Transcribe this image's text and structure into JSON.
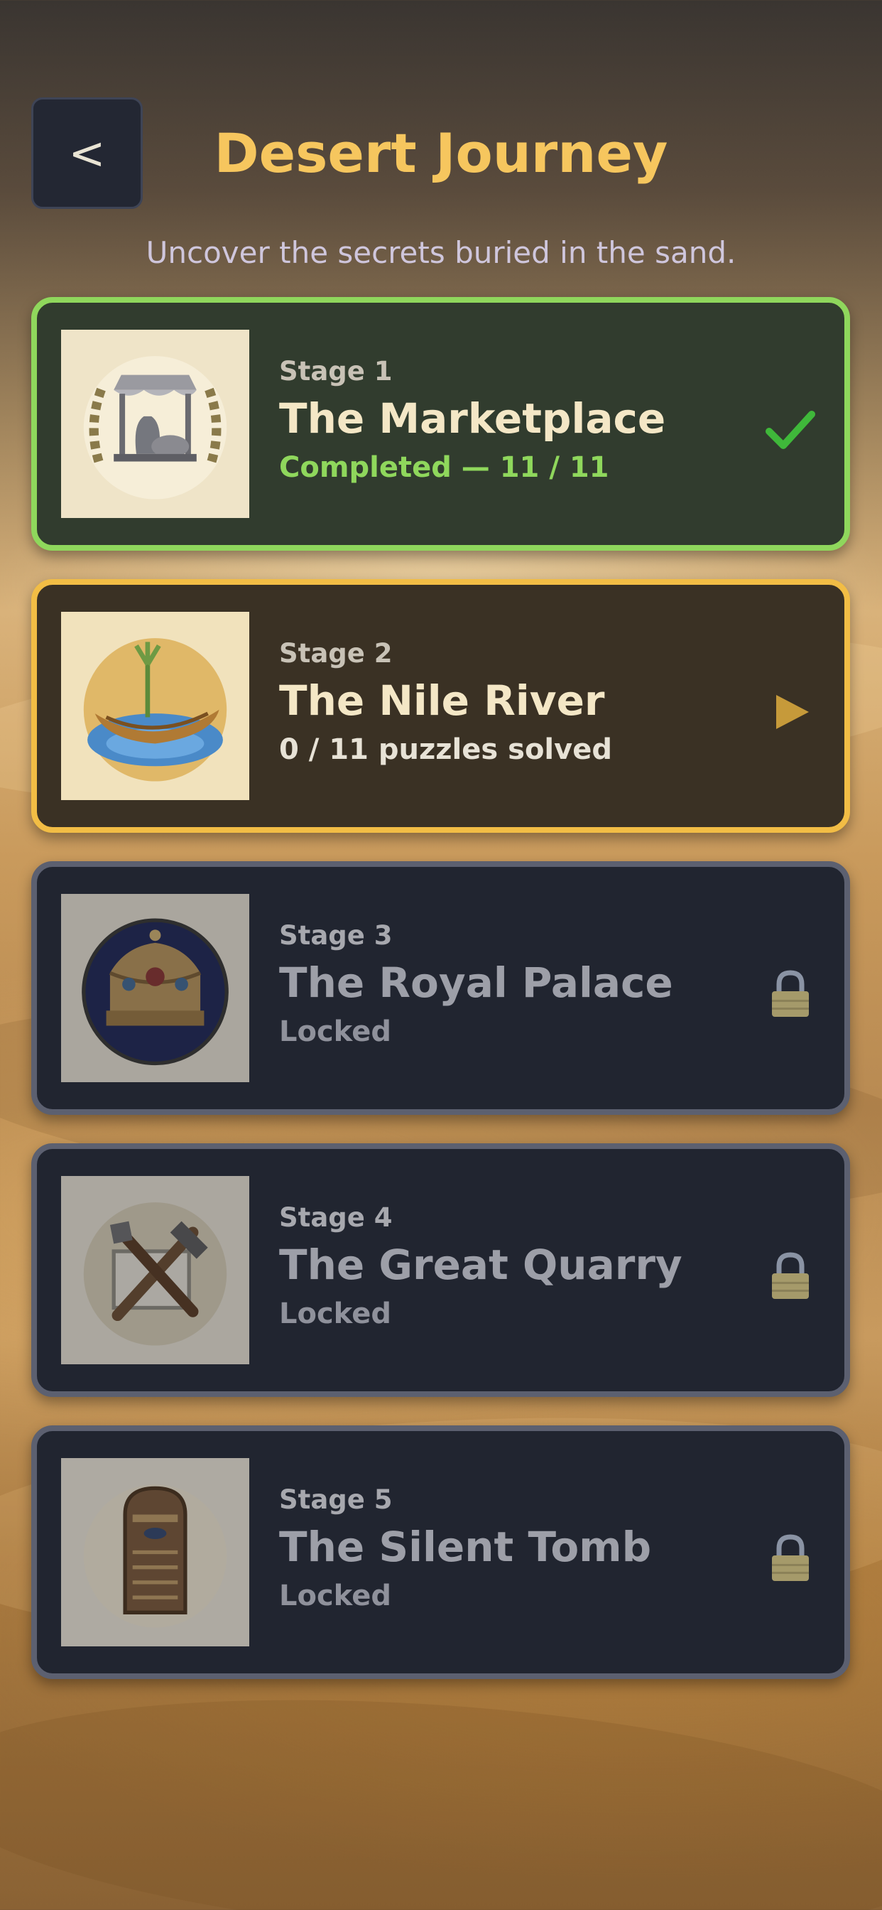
{
  "header": {
    "back_label": "<",
    "title": "Desert Journey",
    "subtitle": "Uncover the secrets buried in the sand."
  },
  "colors": {
    "title": "#f6c65e",
    "completed_accent": "#8fd75c",
    "current_accent": "#f2bd45",
    "locked_border": "#5c6070"
  },
  "stages": [
    {
      "number": "Stage 1",
      "name": "The Marketplace",
      "status": "Completed — 11 / 11",
      "state": "completed",
      "icon": "checkmark-icon",
      "thumbnail": "market-stall-emblem"
    },
    {
      "number": "Stage 2",
      "name": "The Nile River",
      "status": "0 / 11 puzzles solved",
      "state": "current",
      "icon": "play-icon",
      "thumbnail": "river-boat-emblem"
    },
    {
      "number": "Stage 3",
      "name": "The Royal Palace",
      "status": "Locked",
      "state": "locked",
      "icon": "lock-icon",
      "thumbnail": "royal-crown-emblem"
    },
    {
      "number": "Stage 4",
      "name": "The Great Quarry",
      "status": "Locked",
      "state": "locked",
      "icon": "lock-icon",
      "thumbnail": "hammer-chisel-emblem"
    },
    {
      "number": "Stage 5",
      "name": "The Silent Tomb",
      "status": "Locked",
      "state": "locked",
      "icon": "lock-icon",
      "thumbnail": "sarcophagus-emblem"
    }
  ]
}
